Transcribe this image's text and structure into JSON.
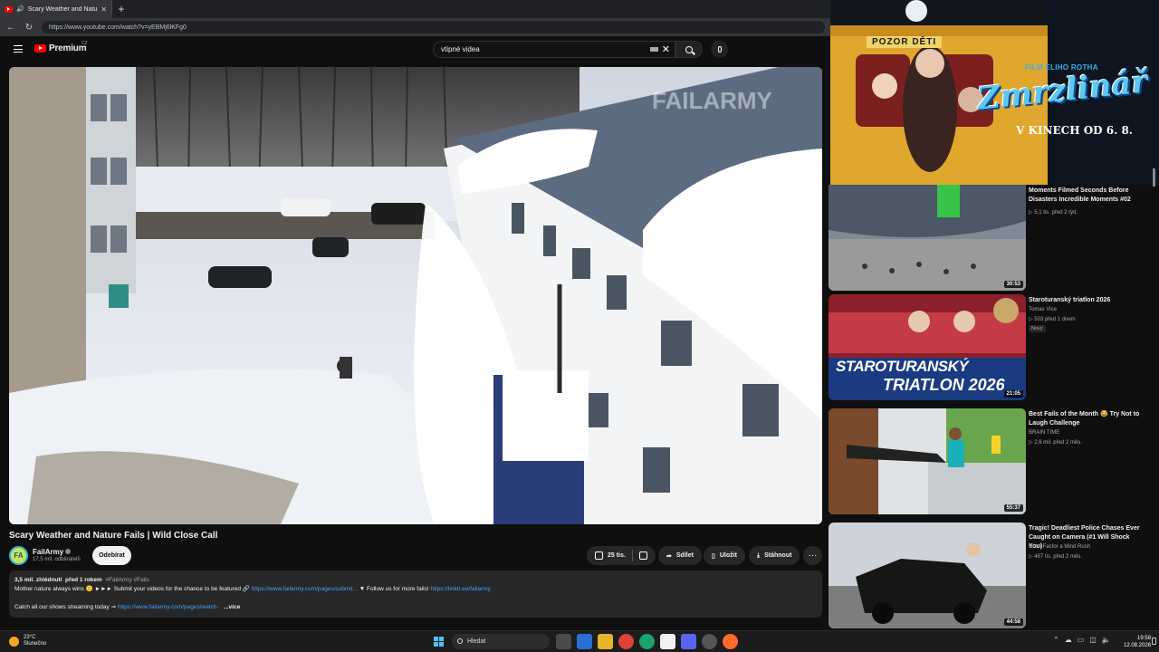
{
  "browser": {
    "tab_title": "Scary Weather and Nature Fails | Wild Close Call",
    "new_tab": "+",
    "url": "https://www.youtube.com/watch?v=yEBMj6lKFg0"
  },
  "header": {
    "logo_text": "Premium",
    "country": "CZ",
    "search_value": "vtipné videa"
  },
  "video": {
    "watermark": "FAILARMY",
    "title": "Scary Weather and Nature Fails | Wild Close Call",
    "channel": "FailArmy",
    "channel_initials": "FA",
    "subscribers": "17,5 mil. odběratelů",
    "subscribe_label": "Odebírat",
    "likes": "25 tis.",
    "share_label": "Sdílet",
    "save_label": "Uložit",
    "download_label": "Stáhnout",
    "more": "···"
  },
  "description": {
    "views": "3,5 mil. zhlédnutí",
    "age": "před 1 rokem",
    "tags": "#FailArmy #Fails",
    "line1_text": "Mother nature always wins 🙃 ►►► Submit your videos for the chance to be featured 🔗",
    "line1_link": "https://www.failarmy.com/pages/submit...",
    "line1_text2": "▼ Follow us for more fails!",
    "line1_link2": "https://linktr.ee/failarmy",
    "line2_text": "Catch all our shows streaming today ➞",
    "line2_link": "https://www.failarmy.com/pages/watch-",
    "more_label": "...více"
  },
  "ad": {
    "sign": "POZOR DĚTI",
    "film_label": "FILM ELIHO ROTHA",
    "brand": "Zmrzlinář",
    "release": "V KINECH OD 6. 8."
  },
  "sidebar": {
    "items": [
      {
        "title": "Moments Filmed Seconds Before Disasters   Incredible Moments #02",
        "channel": "",
        "meta": "▷ 5,1 tis.  před 2 týd.",
        "duration": "30:53",
        "badge": ""
      },
      {
        "title": "Staroturanský triatlon 2026",
        "channel": "Tomas Vice",
        "meta": "▷ 503  před 1 dnem",
        "duration": "21:05",
        "badge": "Nový",
        "thumb_text1": "STAROTURANSKÝ",
        "thumb_text2": "TRIATLON 2026"
      },
      {
        "title": "Best Fails of the Month 😂 Try Not to Laugh Challenge",
        "channel": "BRAIN TIME",
        "meta": "▷ 2,6 mil.  před 2 měs.",
        "duration": "55:37",
        "badge": ""
      },
      {
        "title": "Tragic! Deadliest Police Chases Ever Caught on Camera (#1 Will Shock You)",
        "channel": "Rush Factor a Mind Rush",
        "meta": "▷ 487 tis.  před 2 měs.",
        "duration": "44:58",
        "badge": ""
      }
    ]
  },
  "taskbar": {
    "temperature": "23°C",
    "weather": "Slunečno",
    "search_label": "Hledat",
    "time": "19:58",
    "date": "12.08.2026"
  }
}
